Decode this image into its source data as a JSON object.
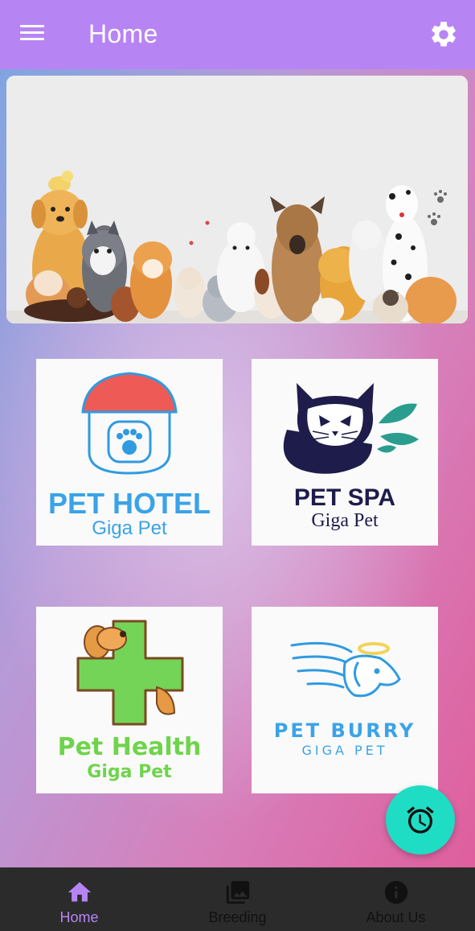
{
  "appbar": {
    "title": "Home",
    "menu_icon": "menu-icon",
    "settings_icon": "gear-icon",
    "color": "#b784f4"
  },
  "banner": {
    "image": "illustration of many dogs and cats sitting together"
  },
  "services": [
    {
      "line1": "PET HOTEL",
      "line2": "Giga Pet",
      "icon": "house-paw-icon",
      "color": "#3aa3e8"
    },
    {
      "line1": "PET SPA",
      "line2": "Giga Pet",
      "icon": "cat-leaf-icon",
      "color": "#1e1c4a"
    },
    {
      "line1": "Pet Health",
      "line2": "Giga Pet",
      "icon": "cross-dog-icon",
      "color": "#6fd44c"
    },
    {
      "line1": "PET BURRY",
      "line2": "GIGA PET",
      "icon": "angel-dog-icon",
      "color": "#3aa3e8"
    }
  ],
  "fab": {
    "icon": "alarm-icon",
    "color": "#1fdcc4"
  },
  "bottom_nav": [
    {
      "label": "Home",
      "icon": "home-icon",
      "active": true
    },
    {
      "label": "Breeding",
      "icon": "photo-library-icon",
      "active": false
    },
    {
      "label": "About Us",
      "icon": "info-icon",
      "active": false
    }
  ]
}
